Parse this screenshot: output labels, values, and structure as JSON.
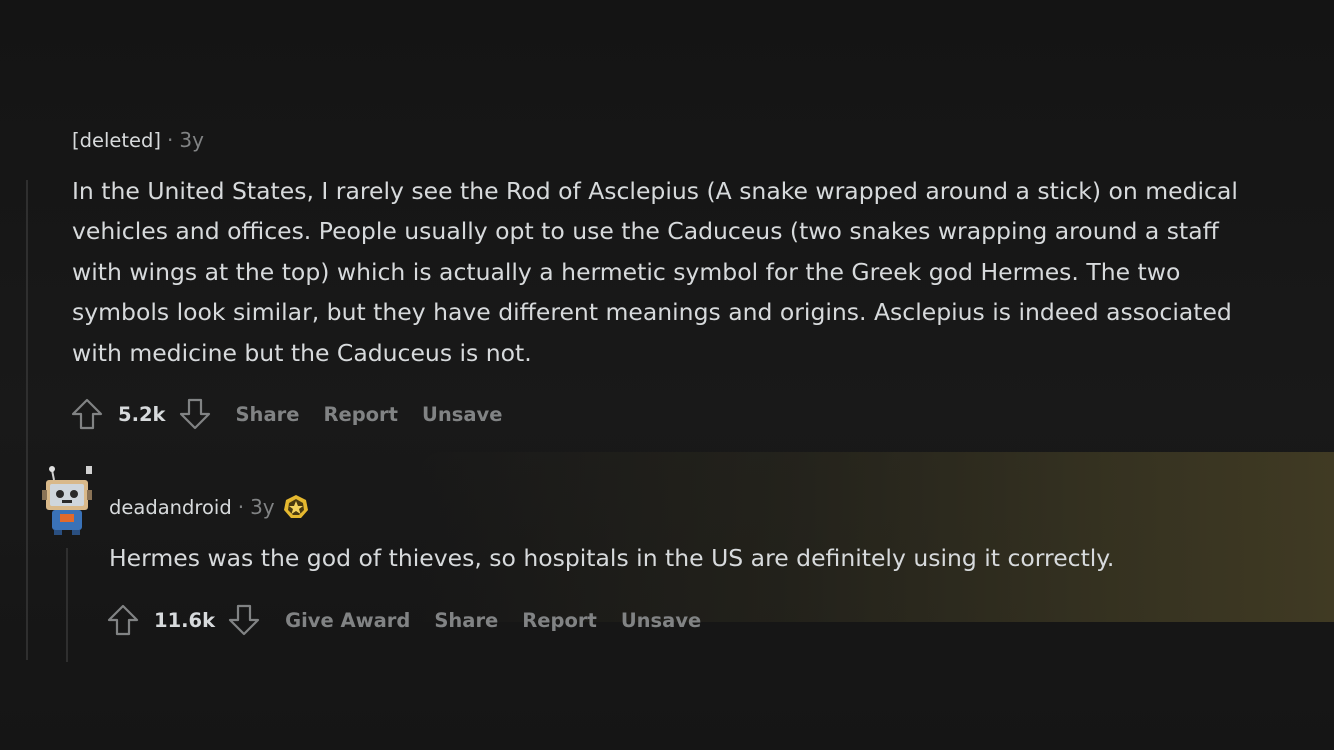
{
  "comments": [
    {
      "author": "[deleted]",
      "separator": "·",
      "age": "3y",
      "body_lines": [
        "In the United States, I rarely see the Rod of Asclepius (A snake wrapped around a stick) on medical",
        "vehicles and offices. People usually opt to use the Caduceus (two snakes wrapping around a staff",
        "with wings at the top) which is actually a hermetic symbol for the Greek god Hermes. The two",
        "symbols look similar, but they have different meanings and origins. Asclepius is indeed associated",
        "with medicine but the Caduceus is not."
      ],
      "score": "5.2k",
      "actions": [
        "Share",
        "Report",
        "Unsave"
      ]
    },
    {
      "author": "deadandroid",
      "separator": "·",
      "age": "3y",
      "body_lines": [
        "Hermes was the god of thieves, so hospitals in the US are definitely using it correctly."
      ],
      "score": "11.6k",
      "actions": [
        "Give Award",
        "Share",
        "Report",
        "Unsave"
      ]
    }
  ],
  "icons": {
    "upvote": "upvote-arrow-icon",
    "downvote": "downvote-arrow-icon",
    "award": "award-badge-icon",
    "avatar": "robot-avatar-icon"
  },
  "colors": {
    "background": "#161616",
    "text": "#d7dadc",
    "muted": "#818384",
    "award": "#e5b82f"
  }
}
